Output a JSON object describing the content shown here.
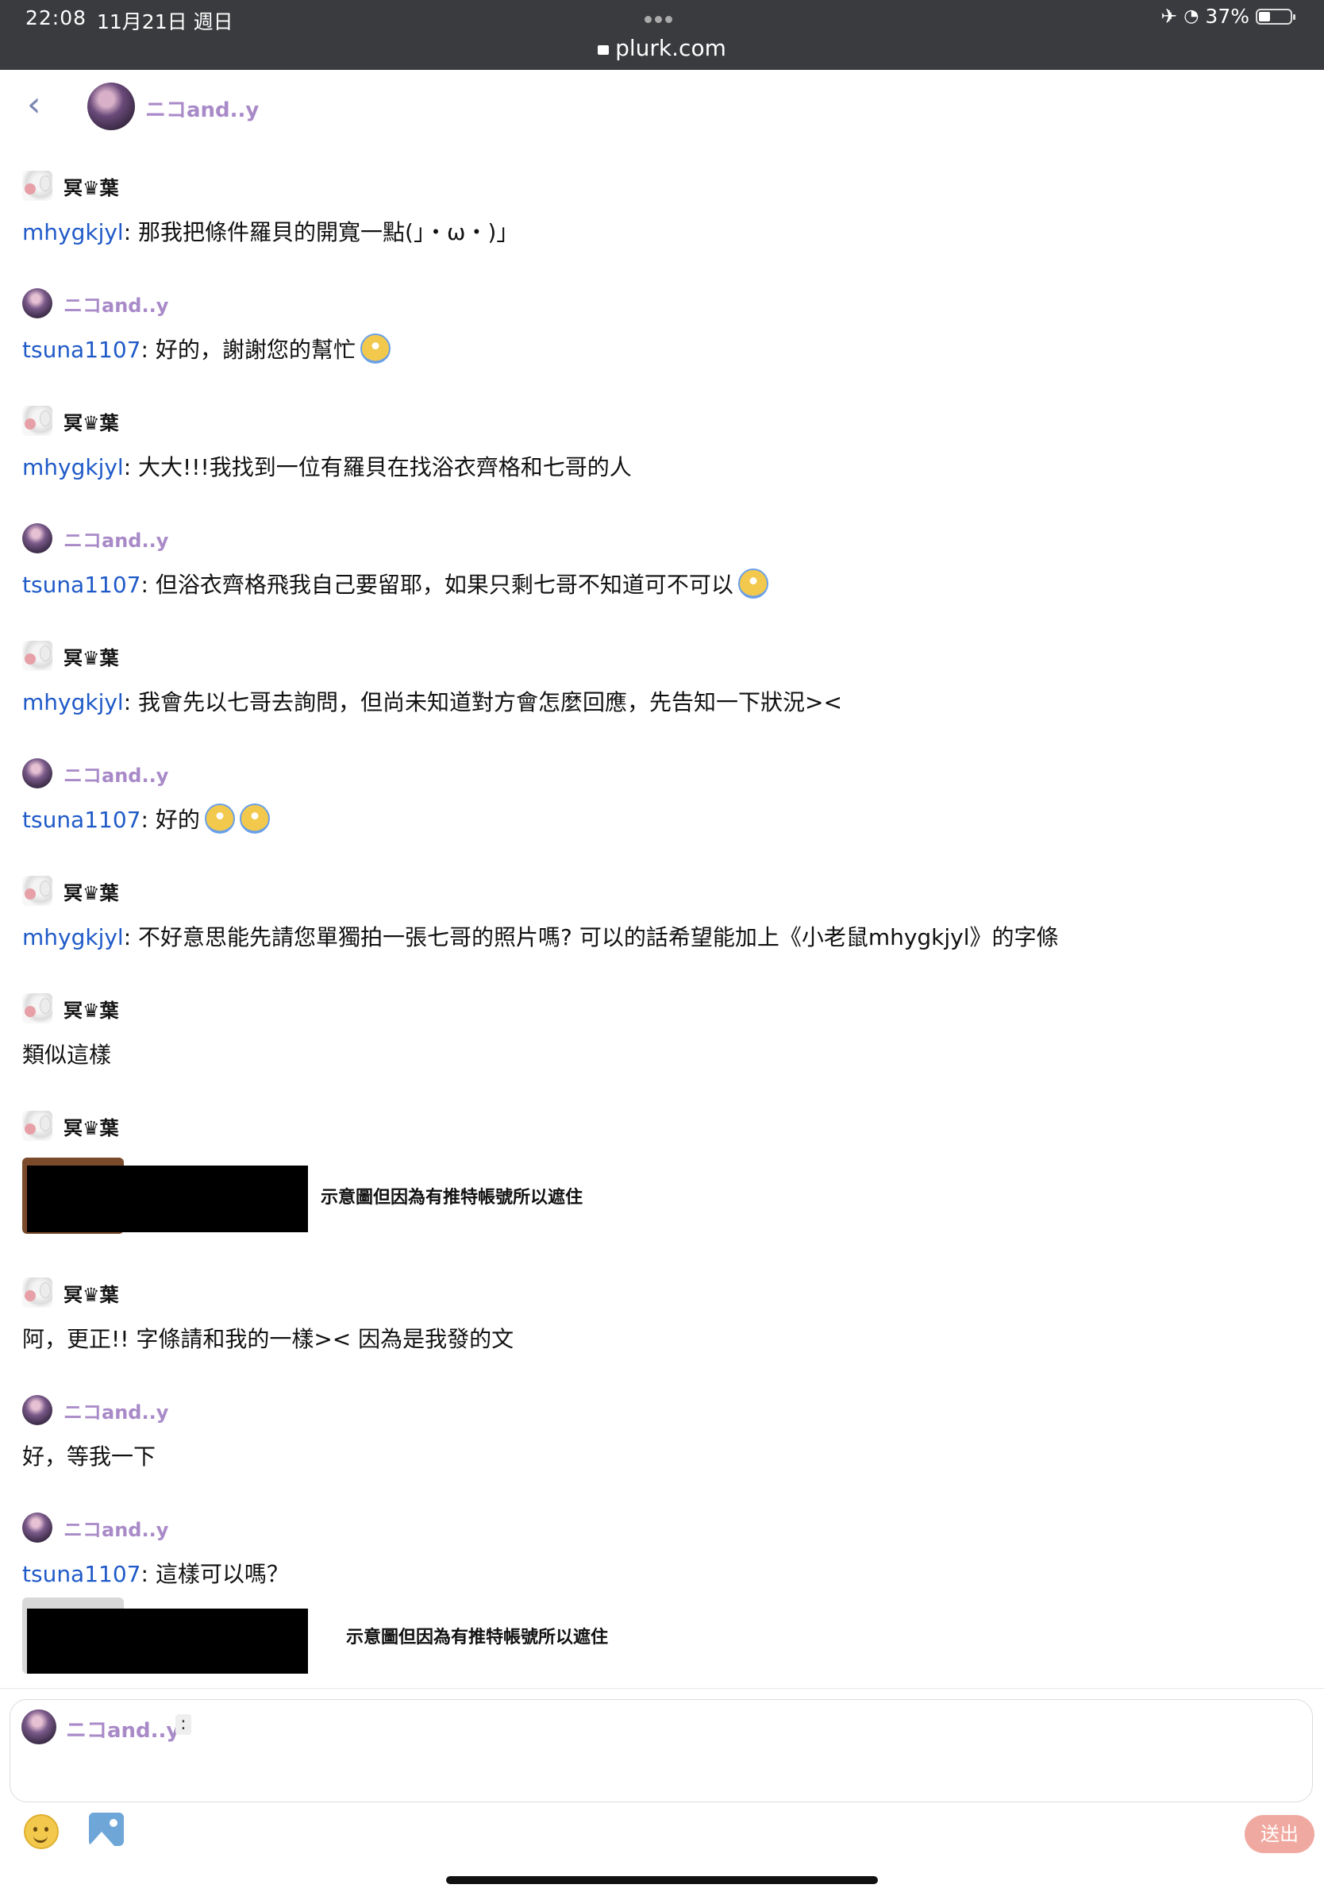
{
  "status_bar": {
    "time": "22:08",
    "date": "11月21日 週日",
    "url": "plurk.com",
    "battery": "37%"
  },
  "header": {
    "name": "ニコand..y"
  },
  "users": {
    "a_name": "冥♛葉",
    "b_name": "ニコand..y"
  },
  "messages": [
    {
      "id": "m1",
      "author": "冥♛葉",
      "uid": "mhygkjyl",
      "text": ": 那我把條件羅貝的開寬一點(」・ω・)」"
    },
    {
      "id": "m2",
      "author": "ニコand..y",
      "uid": "tsuna1107",
      "text": ": 好的，謝謝您的幫忙"
    },
    {
      "id": "m3",
      "author": "冥♛葉",
      "uid": "mhygkjyl",
      "text": ": 大大!!!我找到一位有羅貝在找浴衣齊格和七哥的人"
    },
    {
      "id": "m4",
      "author": "ニコand..y",
      "uid": "tsuna1107",
      "text": ": 但浴衣齊格飛我自己要留耶，如果只剩七哥不知道可不可以"
    },
    {
      "id": "m5",
      "author": "冥♛葉",
      "uid": "mhygkjyl",
      "text": ": 我會先以七哥去詢問，但尚未知道對方會怎麼回應，先告知一下狀況><"
    },
    {
      "id": "m6",
      "author": "ニコand..y",
      "uid": "tsuna1107",
      "text": ": 好的"
    },
    {
      "id": "m7",
      "author": "冥♛葉",
      "uid": "mhygkjyl",
      "text": ": 不好意思能先請您單獨拍一張七哥的照片嗎? 可以的話希望能加上《小老鼠mhygkjyl》的字條"
    },
    {
      "id": "m8",
      "author": "冥♛葉",
      "uid": "",
      "text": "類似這樣"
    },
    {
      "id": "m9",
      "author": "冥♛葉",
      "uid": "",
      "text": "",
      "caption": "示意圖但因為有推特帳號所以遮住"
    },
    {
      "id": "m10",
      "author": "冥♛葉",
      "uid": "",
      "text": "阿，更正!! 字條請和我的一樣>< 因為是我發的文"
    },
    {
      "id": "m11",
      "author": "ニコand..y",
      "uid": "",
      "text": "好，等我一下"
    },
    {
      "id": "m12",
      "author": "ニコand..y",
      "uid": "tsuna1107",
      "text": ": 這樣可以嗎？",
      "caption": "示意圖但因為有推特帳號所以遮住"
    }
  ],
  "composer": {
    "name": "ニコand..y",
    "colon": ":",
    "send_label": "送出"
  },
  "icons": {
    "emoji": "smiley-icon",
    "image": "image-icon",
    "back": "chevron-left-icon",
    "crying": "crying-face-emoticon"
  },
  "colors": {
    "status_bar_bg": "#3a3b3e",
    "uid_link": "#1f5ac8",
    "name_purple": "#a98ac8",
    "send_button": "#f0a9a0"
  }
}
